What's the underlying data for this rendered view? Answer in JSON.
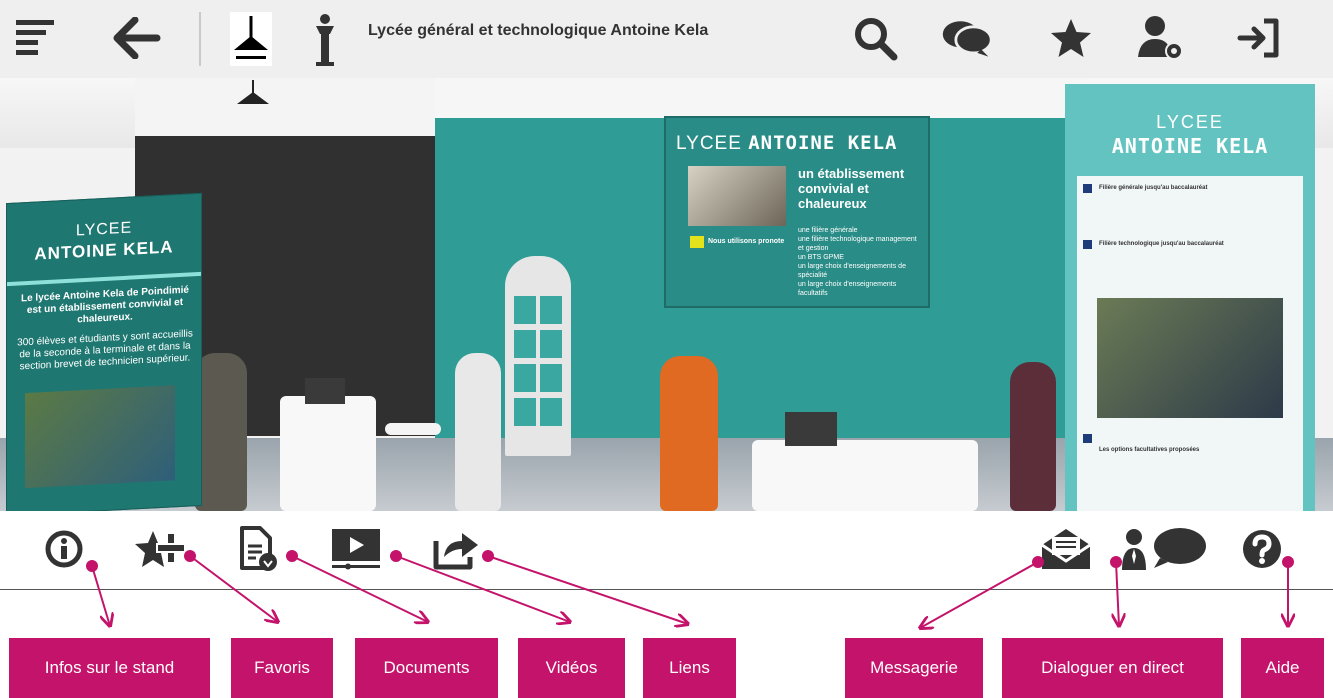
{
  "header": {
    "title": "Lycée général et technologique Antoine Kela",
    "icons": {
      "menu": "menu-icon",
      "back": "back-arrow-icon",
      "logo": "school-logo",
      "statue": "statue-icon",
      "search": "search-icon",
      "chat": "chat-icon",
      "favorite": "star-icon",
      "user_settings": "user-settings-icon",
      "logout": "logout-icon"
    }
  },
  "stand": {
    "left_banner": {
      "line1": "LYCEE",
      "line2": "ANTOINE KELA",
      "text1": "Le lycée Antoine Kela de Poindimié est un établissement convivial et chaleureux.",
      "text2": "300 élèves et étudiants y sont accueillis de la seconde à la terminale et dans la section brevet de technicien supérieur."
    },
    "wall_poster": {
      "title_light": "LYCEE",
      "title_bold": "ANTOINE KELA",
      "subtitle": "un établissement convivial et chaleureux",
      "partner": "Nous utilisons pronote",
      "bullets": [
        "une filière générale",
        "une filière technologique management et gestion",
        "un BTS GPME",
        "un large choix d'enseignements de spécialité",
        "un large choix d'enseignements facultatifs"
      ]
    },
    "right_banner": {
      "line1": "LYCEE",
      "line2": "ANTOINE KELA",
      "section1": "Filière générale jusqu'au baccalauréat",
      "section2": "Filière technologique jusqu'au baccalauréat",
      "section3": "Les options facultatives proposées"
    }
  },
  "colors": {
    "accent": "#c4136a",
    "teal": "#2f9c96",
    "icon": "#333333",
    "topbar": "#efefef"
  },
  "toolbar": {
    "icons": [
      "info-icon",
      "add-favorite-icon",
      "document-download-icon",
      "video-icon",
      "share-icon",
      "mail-icon",
      "live-chat-icon",
      "help-icon"
    ]
  },
  "callouts": [
    {
      "key": "info",
      "label": "Infos sur le stand"
    },
    {
      "key": "favoris",
      "label": "Favoris"
    },
    {
      "key": "documents",
      "label": "Documents"
    },
    {
      "key": "videos",
      "label": "Vidéos"
    },
    {
      "key": "liens",
      "label": "Liens"
    },
    {
      "key": "messagerie",
      "label": "Messagerie"
    },
    {
      "key": "dialogue",
      "label": "Dialoguer en direct"
    },
    {
      "key": "aide",
      "label": "Aide"
    }
  ]
}
